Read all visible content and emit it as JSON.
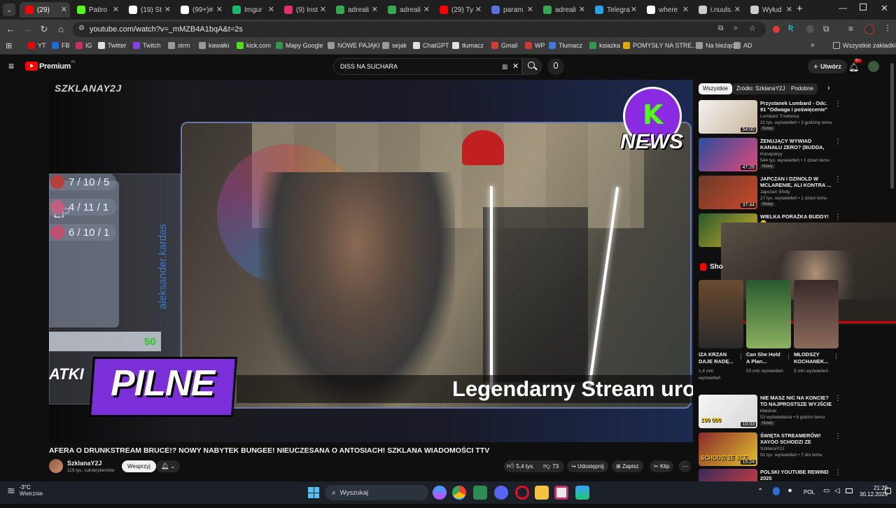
{
  "browser": {
    "tabs": [
      {
        "label": "(29)",
        "favicon": "youtube-icon",
        "color": "#ff0000",
        "active": true
      },
      {
        "label": "Patiro",
        "favicon": "kick-icon",
        "color": "#53fc18"
      },
      {
        "label": "(19) St",
        "favicon": "x-icon",
        "color": "#ffffff"
      },
      {
        "label": "(99+)#",
        "favicon": "tiktok-icon",
        "color": "#ffffff"
      },
      {
        "label": "Imgur",
        "favicon": "imgur-icon",
        "color": "#1bb76e"
      },
      {
        "label": "(9) Inst",
        "favicon": "instagram-icon",
        "color": "#e1306c"
      },
      {
        "label": "adreali",
        "favicon": "drive-icon",
        "color": "#34a853"
      },
      {
        "label": "adreali",
        "favicon": "drive-icon",
        "color": "#34a853"
      },
      {
        "label": "(29) Ty",
        "favicon": "youtube-icon",
        "color": "#ff0000"
      },
      {
        "label": "param",
        "favicon": "param-icon",
        "color": "#5b6ee1"
      },
      {
        "label": "adreali",
        "favicon": "drive-icon",
        "color": "#34a853"
      },
      {
        "label": "Telegra",
        "favicon": "telegram-icon",
        "color": "#2aa3e0"
      },
      {
        "label": "where",
        "favicon": "chatgpt-icon",
        "color": "#ffffff"
      },
      {
        "label": "i.nuuls.",
        "favicon": "globe-icon",
        "color": "#cccccc"
      },
      {
        "label": "Wyłud",
        "favicon": "page-icon",
        "color": "#cccccc"
      }
    ],
    "url": "youtube.com/watch?v=_mMZB4A1bqA&t=2s",
    "bookmarks": [
      {
        "label": "YT",
        "color": "#ff0000"
      },
      {
        "label": "FB",
        "color": "#1877f2"
      },
      {
        "label": "IG",
        "color": "#e1306c"
      },
      {
        "label": "Twitter",
        "color": "#ffffff"
      },
      {
        "label": "Twitch",
        "color": "#9146ff"
      },
      {
        "label": "strm",
        "color": "#aaaaaa"
      },
      {
        "label": "kawałki",
        "color": "#aaaaaa"
      },
      {
        "label": "kick.com",
        "color": "#53fc18"
      },
      {
        "label": "Mapy Google",
        "color": "#34a853"
      },
      {
        "label": "NOWE PAJĄKI",
        "color": "#aaaaaa"
      },
      {
        "label": "sejak",
        "color": "#aaaaaa"
      },
      {
        "label": "ChatGPT",
        "color": "#ffffff"
      },
      {
        "label": "tłumacz",
        "color": "#ffffff"
      },
      {
        "label": "Gmail",
        "color": "#ea4335"
      },
      {
        "label": "WP",
        "color": "#e53935"
      },
      {
        "label": "Tłumacz",
        "color": "#4285f4"
      },
      {
        "label": "ksiazka",
        "color": "#34a853"
      },
      {
        "label": "POMYSŁY NA STRE...",
        "color": "#fbbc04"
      },
      {
        "label": "Na bieżąco",
        "color": "#aaaaaa"
      },
      {
        "label": "AD",
        "color": "#aaaaaa"
      }
    ],
    "all_bookmarks": "Wszystkie zakładki"
  },
  "youtube": {
    "logo": "Premium",
    "logo_region": "PL",
    "search_value": "DISS NA SUCHARA",
    "create_label": "Utwórz",
    "notif_count": "9+",
    "video": {
      "watermark": "SZKLANAY2J",
      "news_logo": "NEWS",
      "pilne": "PILNE",
      "ticker": "Legendarny Stream urodz",
      "side_partial": "ATKI",
      "lp": "LP",
      "stats": [
        "7 / 10 / 5",
        "4 / 11 / 1",
        "6 / 10 / 1"
      ],
      "score": "50",
      "vertical_name": "aleksander.kardas"
    },
    "title": "AFERA O DRUNKSTREAM BRUCE!? NOWY NABYTEK BUNGEE! NIEUCZESANA O ANTOSIACH! SZKLANA WIADOMOŚCI TTV",
    "channel": "SzklanaY2J",
    "subscribers": "119 tys. subskrybentów",
    "support_label": "Wesprzyj",
    "likes": "5,4 tys.",
    "dislikes": "73",
    "share_label": "Udostępnij",
    "save_label": "Zapisz",
    "clip_label": "Klip",
    "chips": [
      "Wszystkie",
      "Źródło: SzklanaY2J",
      "Podobne"
    ],
    "recommendations": [
      {
        "title": "Przystanek Lombard - Odc. 91 \"Odwaga i poświęcenie\"",
        "channel": "Lombard Trzebnica",
        "meta": "21 tys. wyświetleń • 3 godziny temu",
        "badge": "Nowy",
        "duration": "54:00",
        "colors": [
          "#f2f2f2",
          "#c9b49a"
        ]
      },
      {
        "title": "ŻENUJĄCY WYWIAD KANAŁU ZERO? (BUDDA, STANOWSKI, ...",
        "channel": "Konopskyy",
        "meta": "544 tys. wyświetleń • 1 dzień temu",
        "badge": "Nowy",
        "duration": "47:26",
        "colors": [
          "#2a4d9e",
          "#e04a7a"
        ]
      },
      {
        "title": "JAPCZAN I DZINOLD W MCLARENIE, ALI KONTRA ...",
        "channel": "Japczan Shoty",
        "meta": "27 tys. wyświetleń • 1 dzień temu",
        "badge": "Nowy",
        "duration": "37:44",
        "colors": [
          "#6b3b2a",
          "#c94a2a"
        ]
      },
      {
        "title": "WIELKA PORAŻKA BUDDY! 🙁",
        "channel": "",
        "meta": "",
        "badge": "",
        "duration": "",
        "colors": [
          "#2a5a2a",
          "#d0b030"
        ]
      }
    ],
    "shorts_label": "Sho",
    "shorts": [
      {
        "title": "IZA KRZAN DAJE RADĘ...",
        "views": "1,4 mln wyświetleń"
      },
      {
        "title": "Can She Hold A Plan...",
        "views": "53 mln wyświetleń"
      },
      {
        "title": "MŁODSZY KOCHANEK...",
        "views": "5 mln wyświetleń"
      }
    ],
    "recommendations2": [
      {
        "title": "NIE MASZ NIC NA KONCIE? TO NAJPROSTSZE WYJŚCIE",
        "channel": "kbednar",
        "meta": "53 wyświetlenia • 6 godzin temu",
        "badge": "Nowy",
        "duration": "10:03",
        "thumb_text": "100 000",
        "colors": [
          "#f5f5f5",
          "#d8d8d8"
        ]
      },
      {
        "title": "ŚWIĘTA STREAMERÓW! XAYOO SCHODZI ZE SCENY!? ...",
        "channel": "SzklanaY2J",
        "meta": "91 tys. wyświetleń • 7 dni temu",
        "badge": "",
        "duration": "15:24",
        "thumb_text": "SCHODZI ZE SCE",
        "colors": [
          "#8b2a2a",
          "#e0c030"
        ]
      },
      {
        "title": "POLSKI YOUTUBE REWIND 2025",
        "channel": "",
        "meta": "",
        "badge": "",
        "duration": "",
        "thumb_text": "REWIND",
        "colors": [
          "#3a2a5a",
          "#e04040"
        ]
      }
    ]
  },
  "taskbar": {
    "weather_temp": "-3°C",
    "weather_desc": "Wietrznie",
    "search_placeholder": "Wyszukaj",
    "lang": "POL",
    "time": "21:29",
    "date": "30.12.2025"
  }
}
